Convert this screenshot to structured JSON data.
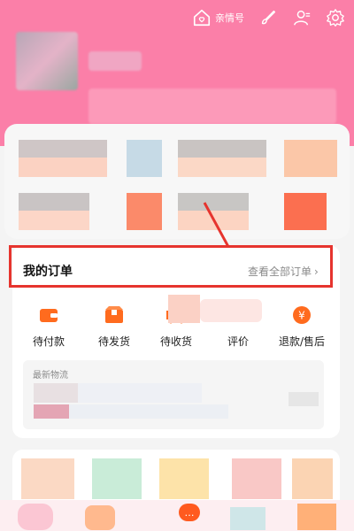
{
  "topbar": {
    "family_label": "亲情号"
  },
  "orders": {
    "title": "我的订单",
    "view_all": "查看全部订单",
    "statuses": [
      {
        "label": "待付款",
        "icon": "wallet-icon"
      },
      {
        "label": "待发货",
        "icon": "package-icon"
      },
      {
        "label": "待收货",
        "icon": "truck-icon"
      },
      {
        "label": "评价",
        "icon": "review-icon"
      },
      {
        "label": "退款/售后",
        "icon": "refund-icon"
      }
    ],
    "latest_logistics": "最新物流"
  },
  "colors": {
    "header_pink": "#fb7fa8",
    "accent_orange": "#ff6b1e",
    "highlight_red": "#e6342e"
  }
}
